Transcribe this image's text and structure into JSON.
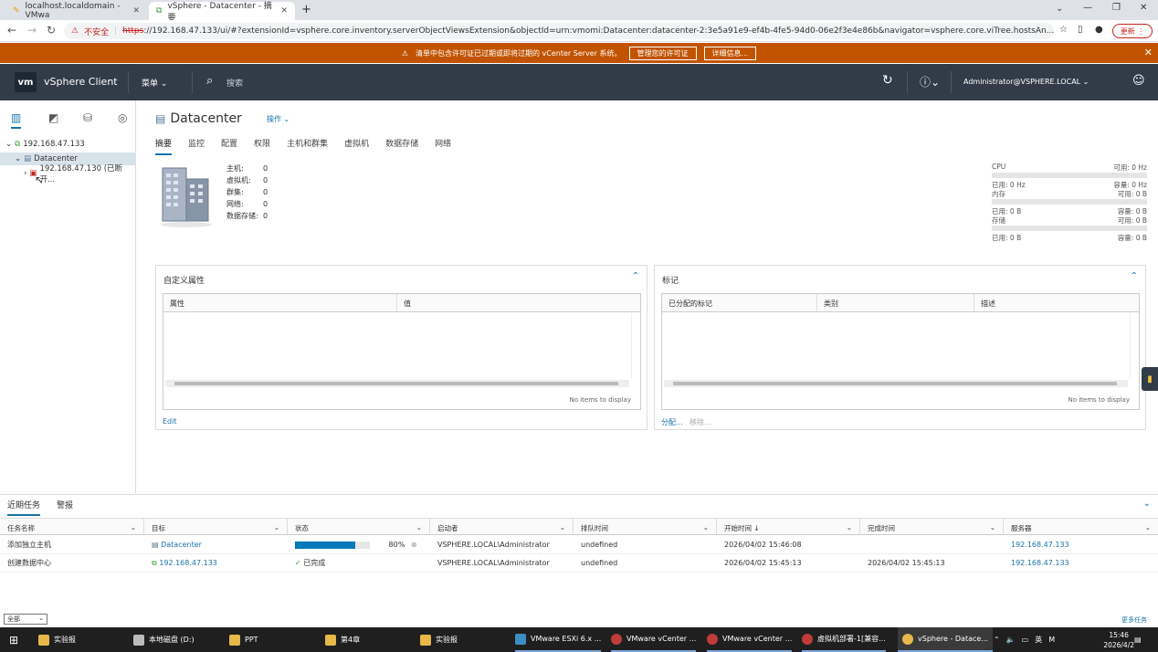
{
  "browser": {
    "tabs": [
      {
        "label": "localhost.localdomain - VMwa"
      },
      {
        "label": "vSphere - Datacenter - 摘要"
      }
    ],
    "new_tab": "+",
    "url_warning": "不安全",
    "url_scheme": "https",
    "url_rest": "://192.168.47.133/ui/#?extensionId=vsphere.core.inventory.serverObjectViewsExtension&objectId=urn:vmomi:Datacenter:datacenter-2:3e5a91e9-ef4b-4fe5-94d0-06e2f3e4e86b&navigator=vsphere.core.viTree.hostsAn...",
    "update_label": "更新"
  },
  "banner": {
    "text": "清单中包含许可证已过期或即将过期的 vCenter Server 系统。",
    "btn1": "管理您的许可证",
    "btn2": "详细信息..."
  },
  "header": {
    "logo": "vm",
    "title": "vSphere Client",
    "menu": "菜单",
    "search": "搜索",
    "user": "Administrator@VSPHERE.LOCAL"
  },
  "tree": {
    "vcenter": "192.168.47.133",
    "datacenter": "Datacenter",
    "host": "192.168.47.130 (已断开..."
  },
  "page": {
    "title": "Datacenter",
    "actions": "操作",
    "tabs": [
      "摘要",
      "监控",
      "配置",
      "权限",
      "主机和群集",
      "虚拟机",
      "数据存储",
      "网络"
    ]
  },
  "stats": [
    {
      "k": "主机:",
      "v": "0"
    },
    {
      "k": "虚拟机:",
      "v": "0"
    },
    {
      "k": "群集:",
      "v": "0"
    },
    {
      "k": "网络:",
      "v": "0"
    },
    {
      "k": "数据存储:",
      "v": "0"
    }
  ],
  "resources": {
    "cpu_label": "CPU",
    "cpu_free": "可用: 0 Hz",
    "cpu_used": "已用: 0 Hz",
    "cpu_cap": "容量: 0 Hz",
    "mem_label": "内存",
    "mem_free": "可用: 0 B",
    "mem_used": "已用: 0 B",
    "mem_cap": "容量: 0 B",
    "sto_label": "存储",
    "sto_free": "可用: 0 B",
    "sto_used": "已用: 0 B",
    "sto_cap": "容量: 0 B"
  },
  "attrs_card": {
    "title": "自定义属性",
    "col1": "属性",
    "col2": "值",
    "empty": "No items to display",
    "edit": "Edit"
  },
  "tags_card": {
    "title": "标记",
    "col1": "已分配的标记",
    "col2": "类别",
    "col3": "描述",
    "empty": "No items to display",
    "assign": "分配...",
    "remove": "移除..."
  },
  "tasks": {
    "tab_recent": "近期任务",
    "tab_alarms": "警报",
    "columns": [
      "任务名称",
      "目标",
      "状态",
      "启动者",
      "排队时间",
      "开始时间 ↓",
      "完成时间",
      "服务器"
    ],
    "rows": [
      {
        "name": "添加独立主机",
        "target": "Datacenter",
        "status_pct": "80%",
        "progress": 0.8,
        "initiator": "VSPHERE.LOCAL\\Administrator",
        "queued": "undefined",
        "start": "2026/04/02 15:46:08",
        "end": "",
        "server": "192.168.47.133"
      },
      {
        "name": "创建数据中心",
        "target": "192.168.47.133",
        "status": "已完成",
        "initiator": "VSPHERE.LOCAL\\Administrator",
        "queued": "undefined",
        "start": "2026/04/02 15:45:13",
        "end": "2026/04/02 15:45:13",
        "server": "192.168.47.133"
      }
    ],
    "filter": "全部",
    "more": "更多任务"
  },
  "taskbar": {
    "items": [
      "实验报",
      "本地磁盘 (D:)",
      "PPT",
      "第4章",
      "实验报",
      "VMware ESXi 6.x ...",
      "VMware vCenter ...",
      "VMware vCenter ...",
      "虚拟机部署-1[兼容...",
      "vSphere - Datace..."
    ],
    "ime": "英",
    "time": "15:46",
    "date": "2026/4/2"
  }
}
